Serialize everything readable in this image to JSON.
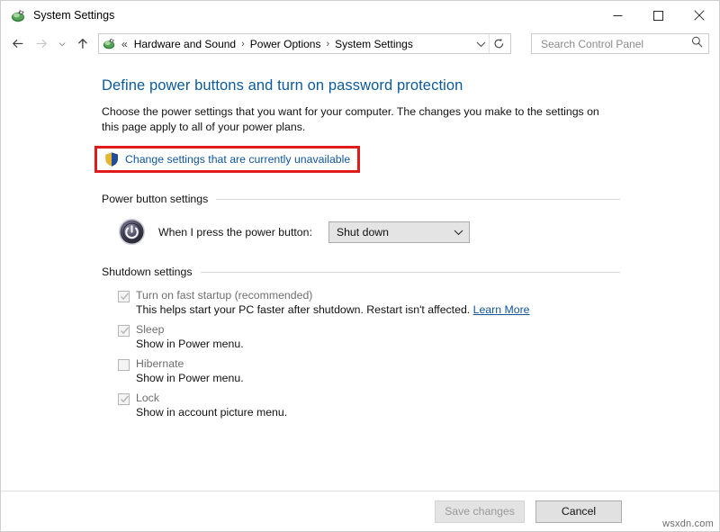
{
  "window": {
    "title": "System Settings",
    "app_icon": "control-panel-icon",
    "controls": {
      "minimize": "minimize-icon",
      "maximize": "maximize-icon",
      "close": "close-icon"
    }
  },
  "navbar": {
    "back": "back-arrow-icon",
    "forward": "forward-arrow-icon",
    "recent": "chevron-down-icon",
    "up": "up-arrow-icon",
    "address_icon": "control-panel-icon",
    "breadcrumb_prefix": "«",
    "breadcrumbs": [
      "Hardware and Sound",
      "Power Options",
      "System Settings"
    ],
    "separator": "›",
    "address_dropdown": "chevron-down-icon",
    "refresh": "refresh-icon",
    "search": {
      "placeholder": "Search Control Panel",
      "value": "",
      "icon": "search-icon"
    }
  },
  "main": {
    "page_title": "Define power buttons and turn on password protection",
    "description": "Choose the power settings that you want for your computer. The changes you make to the settings on this page apply to all of your power plans.",
    "uac_link": {
      "label": "Change settings that are currently unavailable",
      "icon": "uac-shield-icon",
      "highlight_color": "#e01b1b"
    },
    "power_button_group": {
      "label": "Power button settings",
      "icon": "power-button-icon",
      "row_label": "When I press the power button:",
      "dropdown": {
        "value": "Shut down",
        "arrow": "chevron-down-icon"
      }
    },
    "shutdown_group": {
      "label": "Shutdown settings",
      "items": [
        {
          "label": "Turn on fast startup (recommended)",
          "checked": true,
          "enabled": false,
          "description": "This helps start your PC faster after shutdown. Restart isn't affected.",
          "link": "Learn More"
        },
        {
          "label": "Sleep",
          "checked": true,
          "enabled": false,
          "description": "Show in Power menu.",
          "link": ""
        },
        {
          "label": "Hibernate",
          "checked": false,
          "enabled": false,
          "description": "Show in Power menu.",
          "link": ""
        },
        {
          "label": "Lock",
          "checked": true,
          "enabled": false,
          "description": "Show in account picture menu.",
          "link": ""
        }
      ]
    }
  },
  "footer": {
    "save_label": "Save changes",
    "cancel_label": "Cancel"
  },
  "watermark": "wsxdn.com"
}
